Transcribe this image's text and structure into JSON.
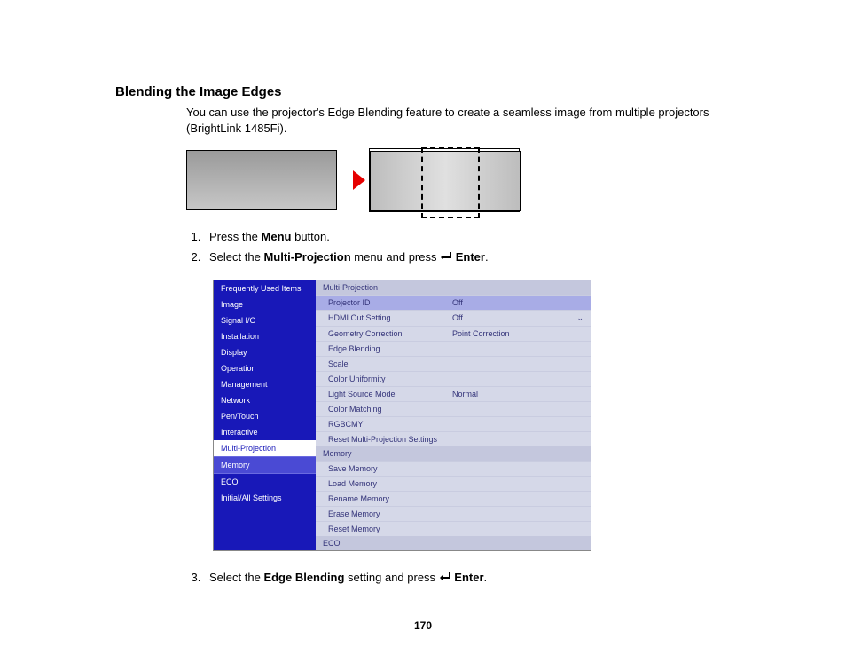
{
  "title": "Blending the Image Edges",
  "intro": "You can use the projector's Edge Blending feature to create a seamless image from multiple projectors (BrightLink 1485Fi).",
  "steps": {
    "s1_a": "Press the ",
    "s1_b": "Menu",
    "s1_c": " button.",
    "s2_a": "Select the ",
    "s2_b": "Multi-Projection",
    "s2_c": " menu and press ",
    "s2_d": "Enter",
    "s2_e": ".",
    "s3_a": "Select the ",
    "s3_b": "Edge Blending",
    "s3_c": " setting and press ",
    "s3_d": "Enter",
    "s3_e": "."
  },
  "menu": {
    "left": [
      "Frequently Used Items",
      "Image",
      "Signal I/O",
      "Installation",
      "Display",
      "Operation",
      "Management",
      "Network",
      "Pen/Touch",
      "Interactive",
      "Multi-Projection",
      "Memory",
      "ECO",
      "Initial/All Settings"
    ],
    "right": {
      "head1": "Multi-Projection",
      "r1": {
        "label": "Projector ID",
        "value": "Off"
      },
      "r2": {
        "label": "HDMI Out Setting",
        "value": "Off"
      },
      "r3": {
        "label": "Geometry Correction",
        "value": "Point Correction"
      },
      "r4": {
        "label": "Edge Blending",
        "value": ""
      },
      "r5": {
        "label": "Scale",
        "value": ""
      },
      "r6": {
        "label": "Color Uniformity",
        "value": ""
      },
      "r7": {
        "label": "Light Source Mode",
        "value": "Normal"
      },
      "r8": {
        "label": "Color Matching",
        "value": ""
      },
      "r9": {
        "label": "RGBCMY",
        "value": ""
      },
      "r10": {
        "label": "Reset Multi-Projection Settings",
        "value": ""
      },
      "head2": "Memory",
      "r11": {
        "label": "Save Memory",
        "value": ""
      },
      "r12": {
        "label": "Load Memory",
        "value": ""
      },
      "r13": {
        "label": "Rename Memory",
        "value": ""
      },
      "r14": {
        "label": "Erase Memory",
        "value": ""
      },
      "r15": {
        "label": "Reset Memory",
        "value": ""
      },
      "head3": "ECO"
    }
  },
  "page_number": "170"
}
